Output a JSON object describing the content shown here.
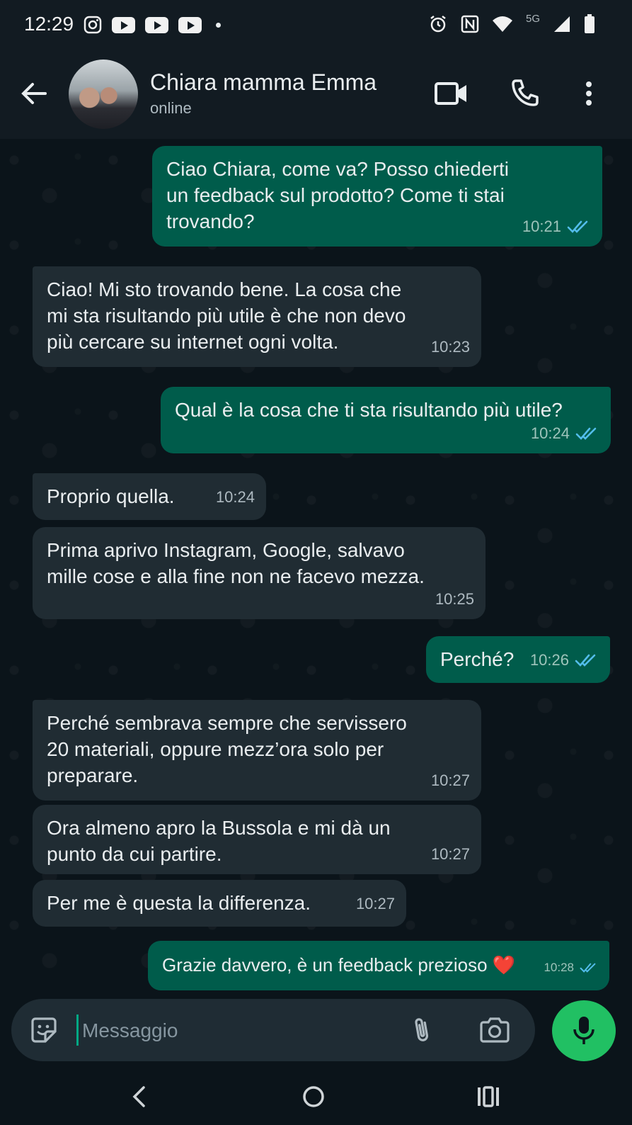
{
  "status_bar": {
    "time": "12:29",
    "network": "5G"
  },
  "header": {
    "contact_name": "Chiara mamma Emma",
    "contact_status": "online"
  },
  "messages": [
    {
      "direction": "out",
      "text": "Ciao Chiara, come va? Posso chiederti\nun feedback sul prodotto? Come ti stai\ntrovando?",
      "time": "10:21",
      "read": true
    },
    {
      "direction": "in",
      "text": "Ciao! Mi sto trovando bene. La cosa che\nmi sta risultando più utile è che non devo\npiù cercare su internet ogni volta.",
      "time": "10:23"
    },
    {
      "direction": "out",
      "text": "Qual è la cosa che ti sta risultando più utile?",
      "time": "10:24",
      "read": true
    },
    {
      "direction": "in",
      "text": "Proprio quella.",
      "time": "10:24"
    },
    {
      "direction": "in",
      "text": "Prima aprivo Instagram, Google, salvavo\nmille cose e alla fine non ne facevo mezza.",
      "time": "10:25"
    },
    {
      "direction": "out",
      "text": "Perché?",
      "time": "10:26",
      "read": true
    },
    {
      "direction": "in",
      "text": "Perché sembrava sempre che servissero\n20 materiali, oppure mezz’ora solo per\npreparare.",
      "time": "10:27"
    },
    {
      "direction": "in",
      "text": "Ora almeno apro la Bussola e mi dà un\npunto da cui partire.",
      "time": "10:27"
    },
    {
      "direction": "in",
      "text": "Per me è questa la differenza.",
      "time": "10:27"
    },
    {
      "direction": "out",
      "text": "Grazie davvero, è un feedback prezioso ❤️",
      "time": "10:28",
      "read": true
    }
  ],
  "composer": {
    "placeholder": "Messaggio"
  },
  "colors": {
    "background": "#0b141a",
    "bubble_in": "#202c33",
    "bubble_out": "#005c4b",
    "accent": "#21c063",
    "read_ticks": "#53bdeb"
  }
}
